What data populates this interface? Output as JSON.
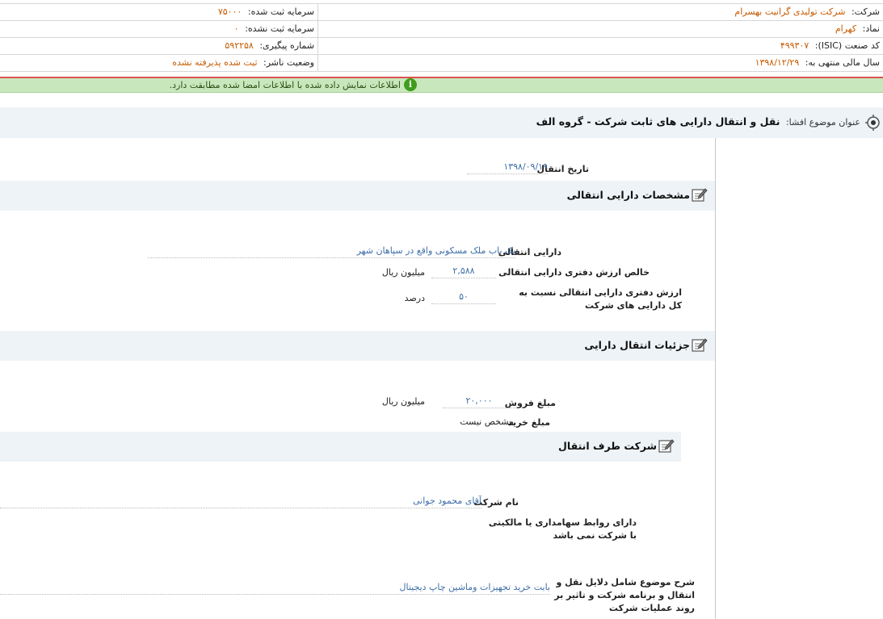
{
  "header": {
    "company_label": "شرکت:",
    "company_value": "شرکت تولیدی گرانیت بهسرام",
    "symbol_label": "نماد:",
    "symbol_value": "کهرام",
    "isic_label": "کد صنعت (ISIC):",
    "isic_value": "۴۹۹۳۰۷",
    "fiscal_label": "سال مالی منتهی به:",
    "fiscal_value": "۱۳۹۸/۱۲/۲۹",
    "reg_capital_label": "سرمایه ثبت شده:",
    "reg_capital_value": "۷۵۰۰۰",
    "unreg_capital_label": "سرمایه ثبت نشده:",
    "unreg_capital_value": "۰",
    "tracking_label": "شماره پیگیری:",
    "tracking_value": "۵۹۲۲۵۸",
    "status_label": "وضعیت ناشر:",
    "status_value": "ثبت شده پذیرفته نشده"
  },
  "message": {
    "text": "اطلاعات نمایش داده شده با اطلاعات امضا شده مطابقت دارد.",
    "icon": "info-icon",
    "icon_glyph": "i"
  },
  "subject": {
    "label": "عنوان موضوع افشا:",
    "title": "نقل و انتقال دارایی های ثابت شرکت - گروه الف",
    "icon": "target-icon"
  },
  "transfer_date": {
    "label": "تاریخ انتقال",
    "value": "۱۳۹۸/۰۹/۱۹"
  },
  "section_asset": {
    "title": "مشخصات دارایی انتقالی",
    "icon": "edit-icon",
    "asset_label": "دارایی انتقالی",
    "asset_value": "یک باب ملک مسکونی واقع در سپاهان شهر",
    "book_value_label": "خالص ارزش دفتری دارایی انتقالی",
    "book_value_value": "۲,۵۸۸",
    "book_value_unit": "میلیون ریال",
    "ratio_label": "ارزش دفتری دارایی انتقالی نسبت به کل دارایی های شرکت",
    "ratio_value": "۵۰",
    "ratio_unit": "درصد"
  },
  "section_details": {
    "title": "جزئیات انتقال دارایی",
    "icon": "edit-icon",
    "sale_label": "مبلغ فروش",
    "sale_value": "۲۰,۰۰۰",
    "sale_unit": "میلیون ریال",
    "purchase_label": "مبلغ خرید",
    "purchase_value": "مشخص نیست"
  },
  "section_party": {
    "title": "شرکت طرف انتقال",
    "icon": "edit-icon",
    "name_label": "نام شرکت",
    "name_value": "آقای محمود جوانی",
    "relation_label": "دارای روابط سهامداری یا مالکیتی با شرکت نمی باشد",
    "description_label": "شرح موضوع شامل دلایل نقل و انتقال و برنامه شرکت و تاثیر بر روند عملیات شرکت",
    "description_value": "بابت خرید تجهیزات وماشین چاپ دیجیتال"
  },
  "colors": {
    "header_value": "#c65a00",
    "field_value": "#3e6ea7",
    "message_bg": "#c9e7bd",
    "section_bg": "#eef3f7",
    "alert_line": "#d9534f"
  }
}
